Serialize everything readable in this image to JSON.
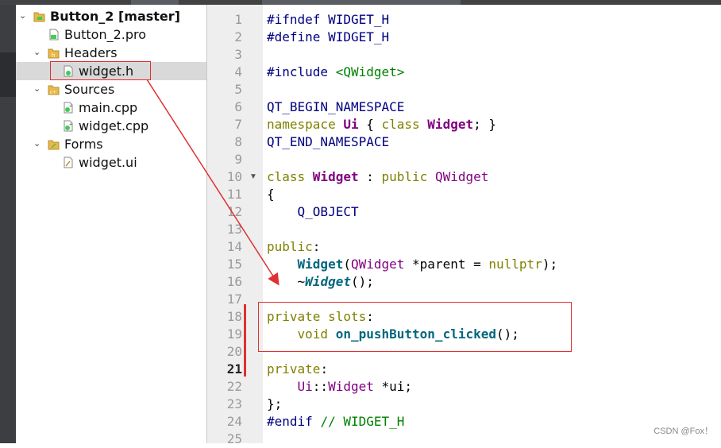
{
  "project_tree": [
    {
      "label": "Button_2 [master]",
      "bold": true,
      "level": 0,
      "expanded": true,
      "icon": "qt-project-icon"
    },
    {
      "label": "Button_2.pro",
      "bold": false,
      "level": 1,
      "icon": "pro-file-icon"
    },
    {
      "label": "Headers",
      "bold": false,
      "level": 1,
      "expanded": true,
      "icon": "headers-folder-icon"
    },
    {
      "label": "widget.h",
      "bold": false,
      "level": 2,
      "icon": "header-file-icon",
      "selected": true
    },
    {
      "label": "Sources",
      "bold": false,
      "level": 1,
      "expanded": true,
      "icon": "sources-folder-icon"
    },
    {
      "label": "main.cpp",
      "bold": false,
      "level": 2,
      "icon": "cpp-file-icon"
    },
    {
      "label": "widget.cpp",
      "bold": false,
      "level": 2,
      "icon": "cpp-file-icon"
    },
    {
      "label": "Forms",
      "bold": false,
      "level": 1,
      "expanded": true,
      "icon": "forms-folder-icon"
    },
    {
      "label": "widget.ui",
      "bold": false,
      "level": 2,
      "icon": "ui-file-icon"
    }
  ],
  "editor": {
    "current_line": 21,
    "fold_marker_line": 10,
    "lines": [
      {
        "n": "1",
        "code": [
          [
            "pp",
            "#ifndef WIDGET_H"
          ]
        ]
      },
      {
        "n": "2",
        "code": [
          [
            "pp",
            "#define WIDGET_H"
          ]
        ]
      },
      {
        "n": "3",
        "code": []
      },
      {
        "n": "4",
        "code": [
          [
            "pp",
            "#include "
          ],
          [
            "str",
            "<QWidget>"
          ]
        ]
      },
      {
        "n": "5",
        "code": []
      },
      {
        "n": "6",
        "code": [
          [
            "mc",
            "QT_BEGIN_NAMESPACE"
          ]
        ]
      },
      {
        "n": "7",
        "code": [
          [
            "kw",
            "namespace "
          ],
          [
            "ty",
            "Ui"
          ],
          [
            "op",
            " { "
          ],
          [
            "kw",
            "class "
          ],
          [
            "ty",
            "Widget"
          ],
          [
            "op",
            "; }"
          ]
        ]
      },
      {
        "n": "8",
        "code": [
          [
            "mc",
            "QT_END_NAMESPACE"
          ]
        ]
      },
      {
        "n": "9",
        "code": []
      },
      {
        "n": "10",
        "code": [
          [
            "kw",
            "class "
          ],
          [
            "ty",
            "Widget"
          ],
          [
            "op",
            " : "
          ],
          [
            "kw",
            "public "
          ],
          [
            "ty2",
            "QWidget"
          ]
        ]
      },
      {
        "n": "11",
        "code": [
          [
            "op",
            "{"
          ]
        ]
      },
      {
        "n": "12",
        "code": [
          [
            "op",
            "    "
          ],
          [
            "mc",
            "Q_OBJECT"
          ]
        ]
      },
      {
        "n": "13",
        "code": []
      },
      {
        "n": "14",
        "code": [
          [
            "kw",
            "public"
          ],
          [
            "op",
            ":"
          ]
        ]
      },
      {
        "n": "15",
        "code": [
          [
            "op",
            "    "
          ],
          [
            "fn",
            "Widget"
          ],
          [
            "op",
            "("
          ],
          [
            "ty2",
            "QWidget"
          ],
          [
            "op",
            " *parent = "
          ],
          [
            "kw",
            "nullptr"
          ],
          [
            "op",
            ");"
          ]
        ]
      },
      {
        "n": "16",
        "code": [
          [
            "op",
            "    ~"
          ],
          [
            "fni",
            "Widget"
          ],
          [
            "op",
            "();"
          ]
        ]
      },
      {
        "n": "17",
        "code": []
      },
      {
        "n": "18",
        "code": [
          [
            "kw",
            "private "
          ],
          [
            "kw",
            "slots"
          ],
          [
            "op",
            ":"
          ]
        ]
      },
      {
        "n": "19",
        "code": [
          [
            "op",
            "    "
          ],
          [
            "kw",
            "void "
          ],
          [
            "fn",
            "on_pushButton_clicked"
          ],
          [
            "op",
            "();"
          ]
        ]
      },
      {
        "n": "20",
        "code": []
      },
      {
        "n": "21",
        "code": [
          [
            "kw",
            "private"
          ],
          [
            "op",
            ":"
          ]
        ]
      },
      {
        "n": "22",
        "code": [
          [
            "op",
            "    "
          ],
          [
            "ty2",
            "Ui"
          ],
          [
            "op",
            "::"
          ],
          [
            "ty2",
            "Widget"
          ],
          [
            "op",
            " *ui;"
          ]
        ]
      },
      {
        "n": "23",
        "code": [
          [
            "op",
            "};"
          ]
        ]
      },
      {
        "n": "24",
        "code": [
          [
            "pp",
            "#endif "
          ],
          [
            "cm",
            "// WIDGET_H"
          ]
        ]
      },
      {
        "n": "25",
        "code": []
      }
    ]
  },
  "annotation": {
    "color": "#e03030"
  },
  "watermark": "CSDN @Fox！"
}
